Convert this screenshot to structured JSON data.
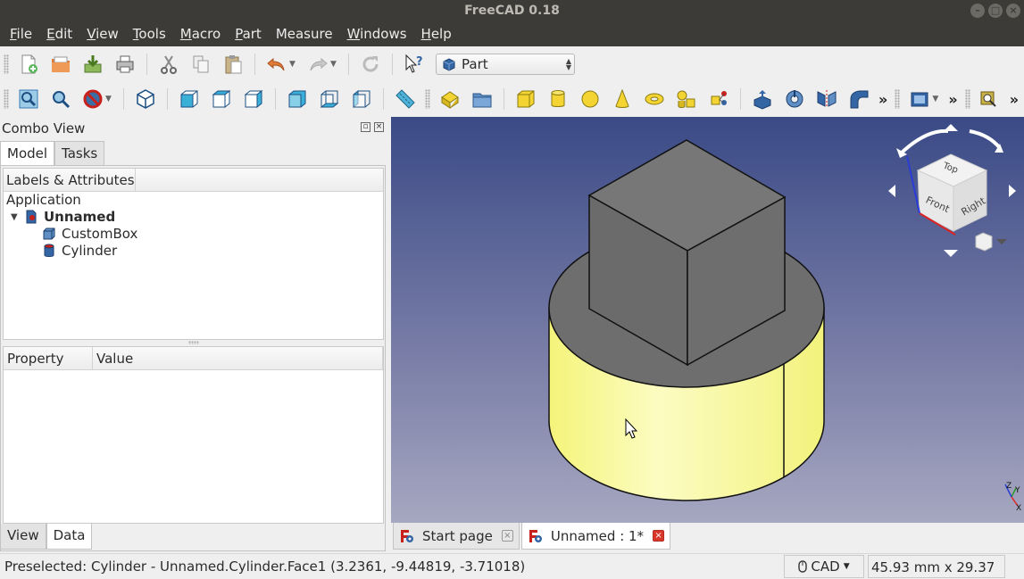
{
  "app": {
    "title": "FreeCAD 0.18",
    "window_buttons": [
      "–",
      "□",
      "×"
    ]
  },
  "menu": [
    {
      "label": "File",
      "u": "F",
      "rest": "ile"
    },
    {
      "label": "Edit",
      "u": "E",
      "rest": "dit"
    },
    {
      "label": "View",
      "u": "V",
      "rest": "iew"
    },
    {
      "label": "Tools",
      "u": "T",
      "rest": "ools"
    },
    {
      "label": "Macro",
      "u": "M",
      "rest": "acro"
    },
    {
      "label": "Part",
      "u": "P",
      "rest": "art"
    },
    {
      "label": "Measure",
      "u": "",
      "rest": "Measure"
    },
    {
      "label": "Windows",
      "u": "W",
      "rest": "indows"
    },
    {
      "label": "Help",
      "u": "H",
      "rest": "elp"
    }
  ],
  "toolbar": {
    "workbench": "Part",
    "overflow": "»"
  },
  "combo": {
    "title": "Combo View",
    "tabs": [
      "Model",
      "Tasks"
    ],
    "bottom_tabs": [
      "View",
      "Data"
    ]
  },
  "tree": {
    "header": "Labels & Attributes",
    "root": "Application",
    "document": "Unnamed",
    "items": [
      "CustomBox",
      "Cylinder"
    ]
  },
  "properties": {
    "columns": [
      "Property",
      "Value"
    ]
  },
  "navcube": {
    "faces": [
      "Top",
      "Front",
      "Right"
    ]
  },
  "axis_labels": [
    "Y",
    "Z",
    "X"
  ],
  "doc_tabs": [
    {
      "label": "Start page",
      "active": false
    },
    {
      "label": "Unnamed : 1*",
      "active": true
    }
  ],
  "status": {
    "text": "Preselected: Cylinder - Unnamed.Cylinder.Face1 (3.2361, -9.44819, -3.71018)",
    "nav_style": "CAD",
    "dimensions": "45.93 mm x 29.37 mm"
  },
  "colors": {
    "cylinder_side": "#fbfba4",
    "box_face": "#6e6e6e",
    "viewport_top": "#3a4a86",
    "viewport_bottom": "#a6a7c0",
    "active_close": "#d9362a"
  }
}
